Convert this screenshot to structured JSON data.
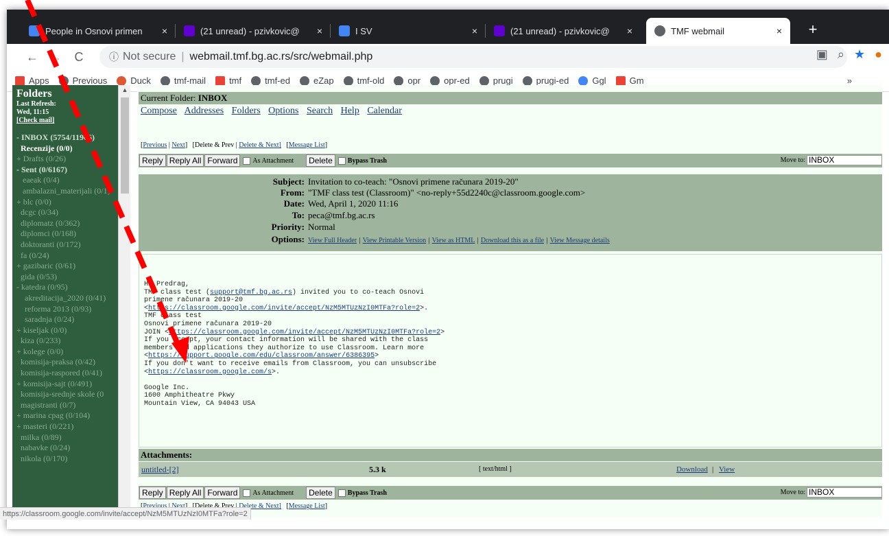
{
  "browser": {
    "tabs": [
      {
        "title": "People in Osnovi primen",
        "fav_color": "#4285f4"
      },
      {
        "title": "(21 unread) - pzivkovic@",
        "fav_color": "#6001d2"
      },
      {
        "title": "I SV",
        "fav_color": "#4285f4"
      },
      {
        "title": "(21 unread) - pzivkovic@",
        "fav_color": "#6001d2"
      },
      {
        "title": "TMF webmail",
        "fav_color": "#5f6368"
      }
    ],
    "close_glyph": "×",
    "new_tab": "+",
    "security": "Not secure",
    "url": "webmail.tmf.bg.ac.rs/src/webmail.php",
    "bookmarks": [
      "Apps",
      "Previous",
      "Duck",
      "tmf-mail",
      "tmf",
      "tmf-ed",
      "eZap",
      "tmf-old",
      "opr",
      "opr-ed",
      "prugi",
      "prugi-ed",
      "Ggl",
      "Gm"
    ],
    "bookmarks_more": "»"
  },
  "folders": {
    "title": "Folders",
    "last_refresh_label": "Last Refresh:",
    "last_refresh_value": "Wed, 11:15",
    "check_mail": "[Check mail]",
    "items": [
      {
        "label": "- INBOX (5754/11966)",
        "style": "bold"
      },
      {
        "label": "  Recenzije (0/0)",
        "style": "hi"
      },
      {
        "label": "+ Drafts (0/26)",
        "style": "n"
      },
      {
        "label": "- Sent (0/6167)",
        "style": "bold"
      },
      {
        "label": "   eaeak (0/4)",
        "style": "n"
      },
      {
        "label": "   ambalazni_materijali (0/1)",
        "style": "n"
      },
      {
        "label": "+ blc (0/0)",
        "style": "n"
      },
      {
        "label": "  dcgc (0/34)",
        "style": "n"
      },
      {
        "label": "  diplomatz (0/362)",
        "style": "n"
      },
      {
        "label": "  diplomci (0/168)",
        "style": "n"
      },
      {
        "label": "  doktoranti (0/172)",
        "style": "n"
      },
      {
        "label": "  fa (0/24)",
        "style": "n"
      },
      {
        "label": "+ gazibaric (0/61)",
        "style": "n"
      },
      {
        "label": "  gida (0/53)",
        "style": "n"
      },
      {
        "label": "- katedra (0/95)",
        "style": "n"
      },
      {
        "label": "    akreditacija_2020 (0/41)",
        "style": "n"
      },
      {
        "label": "    reforma 2013 (0/93)",
        "style": "n"
      },
      {
        "label": "    saradnja (0/24)",
        "style": "n"
      },
      {
        "label": "+ kiseljak (0/0)",
        "style": "n"
      },
      {
        "label": "  kiza (0/233)",
        "style": "n"
      },
      {
        "label": "+ kolege (0/0)",
        "style": "n"
      },
      {
        "label": "  komisija-praksa (0/42)",
        "style": "n"
      },
      {
        "label": "  komisija-raspored (0/41)",
        "style": "n"
      },
      {
        "label": "+ komisija-sajt (0/491)",
        "style": "n"
      },
      {
        "label": "  komisija-srednje skole (0",
        "style": "n"
      },
      {
        "label": "  magistranti (0/7)",
        "style": "n"
      },
      {
        "label": "+ marina cpag (0/104)",
        "style": "n"
      },
      {
        "label": "+ masteri (0/221)",
        "style": "n"
      },
      {
        "label": "  milka (0/89)",
        "style": "n"
      },
      {
        "label": "  nabavke (0/24)",
        "style": "n"
      },
      {
        "label": "  nikola (0/170)",
        "style": "n"
      }
    ]
  },
  "main": {
    "current_folder_label": "Current Folder: ",
    "current_folder": "INBOX",
    "links": [
      "Compose",
      "Addresses",
      "Folders",
      "Options",
      "Search",
      "Help",
      "Calendar"
    ],
    "nav": {
      "previous": "Previous",
      "next": "Next",
      "delete_prev": "[Delete & Prev",
      "delete_next": "Delete & Next]",
      "message_list": "Message List"
    },
    "buttons": {
      "reply": "Reply",
      "reply_all": "Reply All",
      "forward": "Forward",
      "as_attachment": "As Attachment",
      "delete": "Delete",
      "bypass_trash": "Bypass Trash",
      "move_to": "Move to:",
      "move_target": "INBOX"
    },
    "headers": [
      {
        "key": "Subject:",
        "value": "Invitation to co-teach: \"Osnovi primene računara 2019-20\""
      },
      {
        "key": "From:",
        "value": "\"TMF class test (Classroom)\" <no-reply+55d2240c@classroom.google.com>"
      },
      {
        "key": "Date:",
        "value": "Wed, April 1, 2020 11:16"
      },
      {
        "key": "To:",
        "value": "peca@tmf.bg.ac.rs"
      },
      {
        "key": "Priority:",
        "value": "Normal"
      }
    ],
    "options_label": "Options:",
    "options": [
      "View Full Header",
      "View Printable Version",
      "View as HTML",
      "Download this as a file",
      "View Message details"
    ],
    "body": {
      "l1": "Hi Predrag,",
      "l2a": "TMF class test (",
      "l2link": "support@tmf.bg.ac.rs",
      "l2b": ") invited you to co-teach Osnovi",
      "l3": "primene računara 2019-20",
      "l4a": "<",
      "l4link": "https://classroom.google.com/invite/accept/NzM5MTUzNzI0MTFa?role=2",
      "l4b": ">.",
      "l5": "TMF class test",
      "l6": "Osnovi primene računara 2019-20",
      "l7a": "JOIN <",
      "l7link": "https://classroom.google.com/invite/accept/NzM5MTUzNzI0MTFa?role=2",
      "l7b": ">",
      "l8": "If you accept, your contact information will be shared with the class",
      "l9": "members and applications they authorize to use Classroom. Learn more",
      "l10a": "<",
      "l10link": "https://support.google.com/edu/classroom/answer/6386395",
      "l10b": ">",
      "l11": "If you don't want to receive emails from Classroom, you can unsubscribe",
      "l12a": "<",
      "l12link": "https://classroom.google.com/s",
      "l12b": ">.",
      "l13": "Google Inc.",
      "l14": "1600 Amphitheatre Pkwy",
      "l15": "Mountain View, CA 94043 USA"
    },
    "attachments": {
      "title": "Attachments:",
      "name": "untitled-[2]",
      "size": "5.3 k",
      "type": "[ text/html ]",
      "download": "Download",
      "view": "View"
    }
  },
  "status_url": "https://classroom.google.com/invite/accept/NzM5MTUzNzI0MTFa?role=2",
  "annotation_color": "#ff0000"
}
